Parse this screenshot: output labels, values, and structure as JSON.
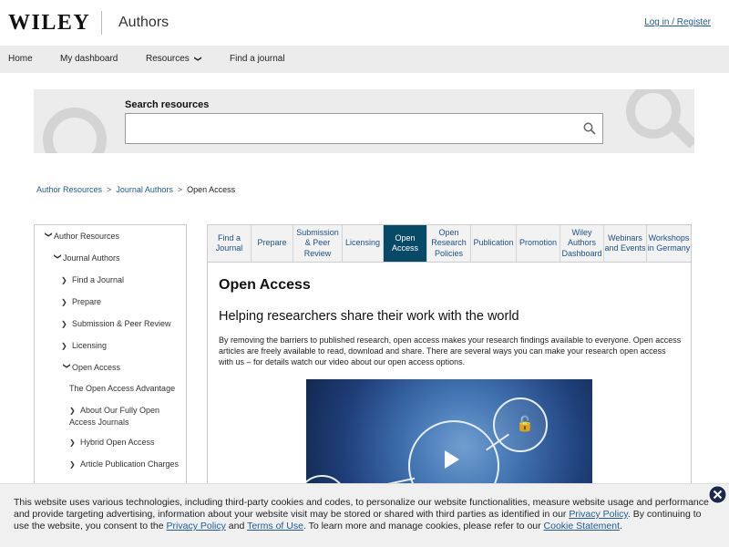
{
  "header": {
    "logo": "WILEY",
    "site_title": "Authors",
    "login_link": "Log in / Register"
  },
  "nav": {
    "items": [
      {
        "label": "Home"
      },
      {
        "label": "My dashboard"
      },
      {
        "label": "Resources"
      },
      {
        "label": "Find a journal"
      }
    ]
  },
  "search": {
    "label": "Search resources",
    "value": "",
    "placeholder": ""
  },
  "breadcrumb": {
    "items": [
      "Author Resources",
      "Journal Authors",
      "Open Access"
    ]
  },
  "sidebar": {
    "items": [
      {
        "label": "Author Resources"
      },
      {
        "label": "Journal Authors"
      },
      {
        "label": "Find a Journal"
      },
      {
        "label": "Prepare"
      },
      {
        "label": "Submission & Peer Review"
      },
      {
        "label": "Licensing"
      },
      {
        "label": "Open Access"
      },
      {
        "label": "The Open Access Advantage"
      },
      {
        "label": "About Our Fully Open Access Journals"
      },
      {
        "label": "Hybrid Open Access"
      },
      {
        "label": "Article Publication Charges"
      }
    ]
  },
  "tabs": [
    {
      "label": "Find a Journal"
    },
    {
      "label": "Prepare"
    },
    {
      "label": "Submission & Peer Review"
    },
    {
      "label": "Licensing"
    },
    {
      "label": "Open Access"
    },
    {
      "label": "Open Research Policies"
    },
    {
      "label": "Publication"
    },
    {
      "label": "Promotion"
    },
    {
      "label": "Wiley Authors Dashboard"
    },
    {
      "label": "Webinars and Events"
    },
    {
      "label": "Workshops in Germany"
    }
  ],
  "content": {
    "title": "Open Access",
    "subtitle": "Helping researchers share their work with the world",
    "paragraph": "By removing the barriers to published research, open access makes your research findings available to everyone. Open access articles are freely available to read, download and share. There are several ways you can make your research open access with us – for details watch our video about our open access options."
  },
  "cookie": {
    "text_1": "This website uses various technologies, including third-party cookies and codes, to personalize our website functionalities, measure website usage and performance and provide targeting advertising, information about your website visit may be stored or shared with third parties as identified in our ",
    "privacy_link_1": "Privacy Policy",
    "text_2": ". By continuing to use the website, you consent to the ",
    "privacy_link_2": "Privacy Policy",
    "text_3": " and ",
    "terms_link": "Terms of Use",
    "text_4": ". To learn more and manage cookies, please refer to our ",
    "cookie_statement_link": "Cookie Statement",
    "text_5": "."
  },
  "colors": {
    "active_tab": "#074a68",
    "link": "#1f5a96",
    "nav_bg": "#ececec"
  }
}
